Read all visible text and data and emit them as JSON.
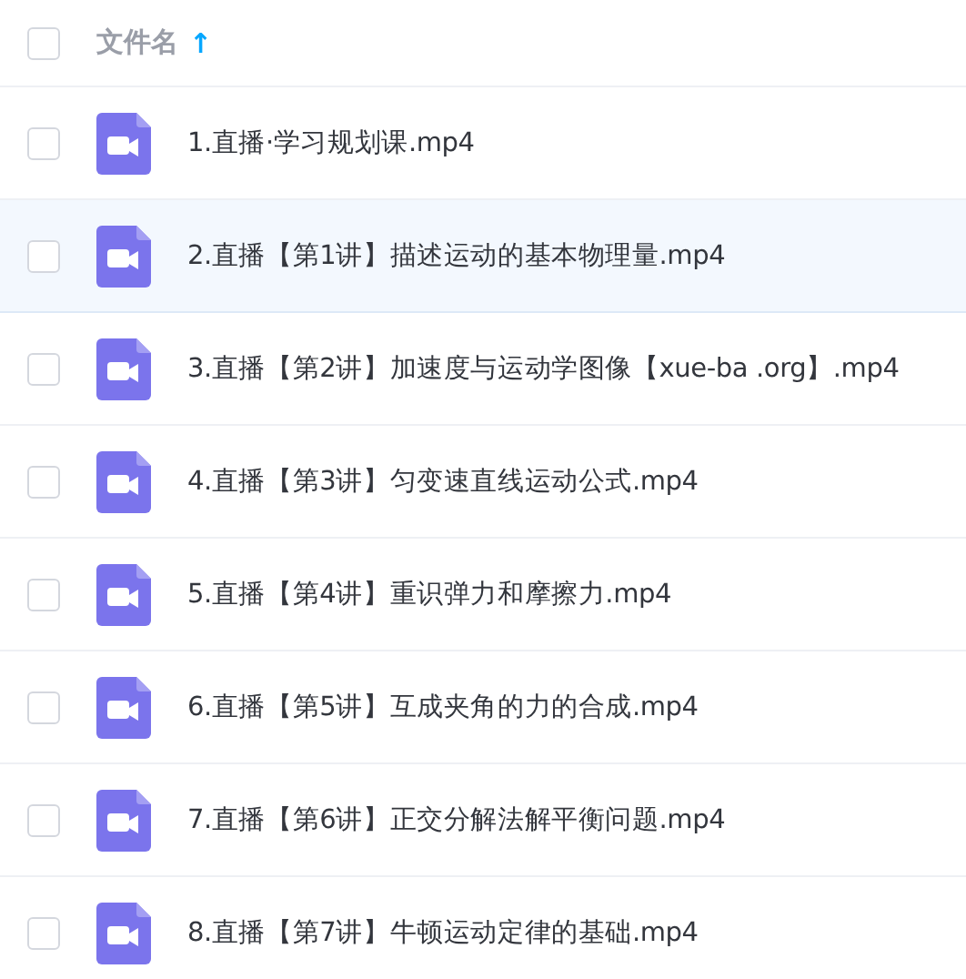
{
  "header": {
    "checked": false,
    "column_label": "文件名",
    "sort_arrow": "↑"
  },
  "files": [
    {
      "name": "1.直播·学习规划课.mp4",
      "checked": false,
      "highlighted": false
    },
    {
      "name": "2.直播【第1讲】描述运动的基本物理量.mp4",
      "checked": false,
      "highlighted": true
    },
    {
      "name": "3.直播【第2讲】加速度与运动学图像【xue-ba .org】.mp4",
      "checked": false,
      "highlighted": false
    },
    {
      "name": "4.直播【第3讲】匀变速直线运动公式.mp4",
      "checked": false,
      "highlighted": false
    },
    {
      "name": "5.直播【第4讲】重识弹力和摩擦力.mp4",
      "checked": false,
      "highlighted": false
    },
    {
      "name": "6.直播【第5讲】互成夹角的力的合成.mp4",
      "checked": false,
      "highlighted": false
    },
    {
      "name": "7.直播【第6讲】正交分解法解平衡问题.mp4",
      "checked": false,
      "highlighted": false
    },
    {
      "name": "8.直播【第7讲】牛顿运动定律的基础.mp4",
      "checked": false,
      "highlighted": false
    }
  ]
}
